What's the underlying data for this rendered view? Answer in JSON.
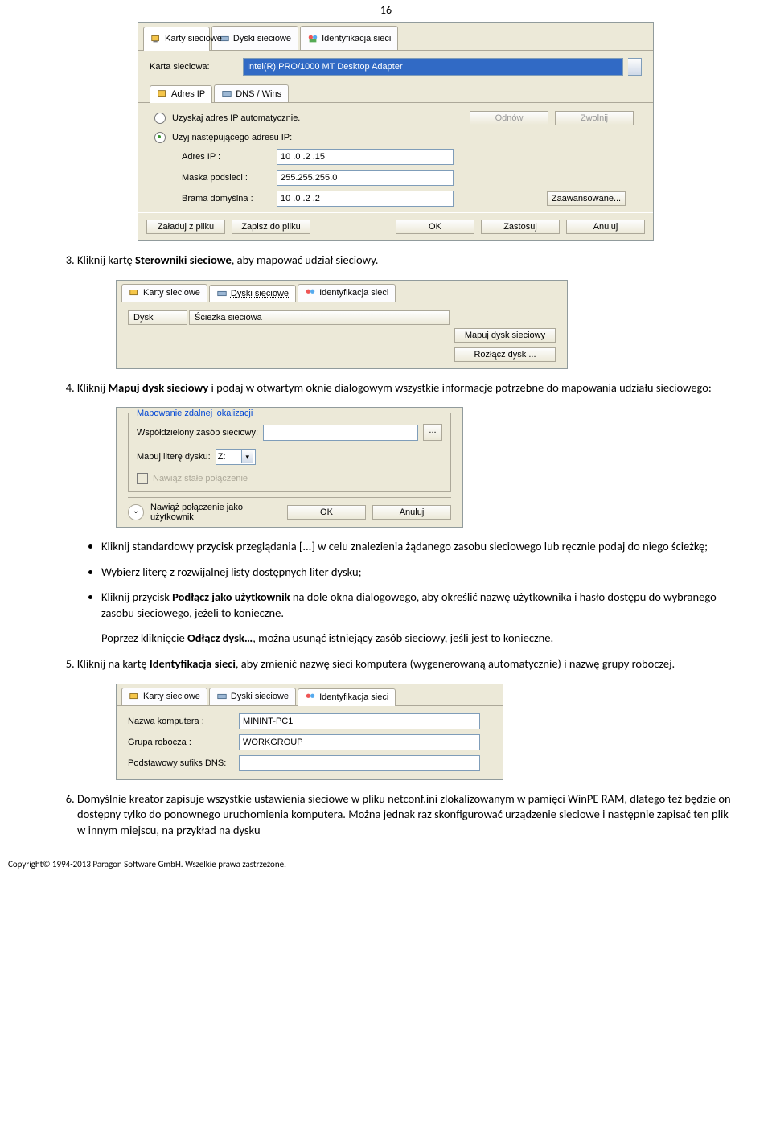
{
  "page_number": "16",
  "panel1": {
    "tabs": [
      "Karty sieciowe",
      "Dyski sieciowe",
      "Identyfikacja sieci"
    ],
    "adapter_label": "Karta sieciowa:",
    "adapter_value": "Intel(R) PRO/1000 MT Desktop Adapter",
    "inner_tabs": [
      "Adres IP",
      "DNS / Wins"
    ],
    "auto_ip": "Uzyskaj adres IP automatycznie.",
    "manual_ip": "Użyj następującego adresu IP:",
    "btn_refresh": "Odnów",
    "btn_release": "Zwolnij",
    "ip_label": "Adres IP :",
    "ip_value": "10 .0 .2 .15",
    "mask_label": "Maska podsieci :",
    "mask_value": "255.255.255.0",
    "gw_label": "Brama domyślna :",
    "gw_value": "10 .0 .2 .2",
    "btn_advanced": "Zaawansowane...",
    "btn_load": "Załaduj z pliku",
    "btn_save": "Zapisz do pliku",
    "btn_ok": "OK",
    "btn_apply": "Zastosuj",
    "btn_cancel": "Anuluj"
  },
  "step3": "Kliknij kartę <b>Sterowniki sieciowe</b>, aby mapować udział sieciowy.",
  "panel2": {
    "hdr_disk": "Dysk",
    "hdr_path": "Ścieżka sieciowa",
    "btn_map": "Mapuj dysk sieciowy",
    "btn_disconnect": "Rozłącz dysk ..."
  },
  "step4_intro": "Kliknij <b>Mapuj dysk sieciowy</b> i podaj w otwartym oknie dialogowym wszystkie informacje potrzebne do mapowania udziału sieciowego:",
  "panel3": {
    "legend": "Mapowanie zdalnej lokalizacji",
    "share_label": "Współdzielony zasób sieciowy:",
    "letter_label": "Mapuj literę dysku:",
    "letter_value": "Z:",
    "persist": "Nawiąż stałe połączenie",
    "connect_as": "Nawiąż połączenie jako użytkownik",
    "btn_ok": "OK",
    "btn_cancel": "Anuluj"
  },
  "bullets": {
    "b1": "Kliknij standardowy przycisk przeglądania [...] w celu znalezienia żądanego zasobu sieciowego lub ręcznie podaj do niego ścieżkę;",
    "b2": "Wybierz literę z rozwijalnej listy dostępnych liter dysku;",
    "b3": "Kliknij przycisk <b>Podłącz jako użytkownik</b> na dole okna dialogowego, aby określić nazwę użytkownika i hasło dostępu do wybranego zasobu sieciowego, jeżeli to konieczne.",
    "b_extra": "Poprzez kliknięcie <b>Odłącz dysk…</b>, można usunąć istniejący zasób sieciowy, jeśli jest to konieczne."
  },
  "step5": "Kliknij na kartę <b>Identyfikacja sieci</b>, aby zmienić nazwę sieci komputera (wygenerowaną automatycznie) i nazwę grupy roboczej.",
  "panel4": {
    "name_label": "Nazwa komputera :",
    "name_value": "MININT-PC1",
    "group_label": "Grupa robocza :",
    "group_value": "WORKGROUP",
    "dns_label": "Podstawowy sufiks DNS:"
  },
  "step6": "Domyślnie kreator zapisuje wszystkie ustawienia sieciowe w pliku netconf.ini zlokalizowanym w pamięci WinPE RAM, dlatego też będzie on dostępny tylko do ponownego uruchomienia komputera. Można jednak raz skonfigurować urządzenie sieciowe i następnie zapisać ten plik w innym miejscu, na przykład na dysku",
  "footer": "Copyright© 1994-2013 Paragon Software GmbH. Wszelkie prawa zastrzeżone."
}
